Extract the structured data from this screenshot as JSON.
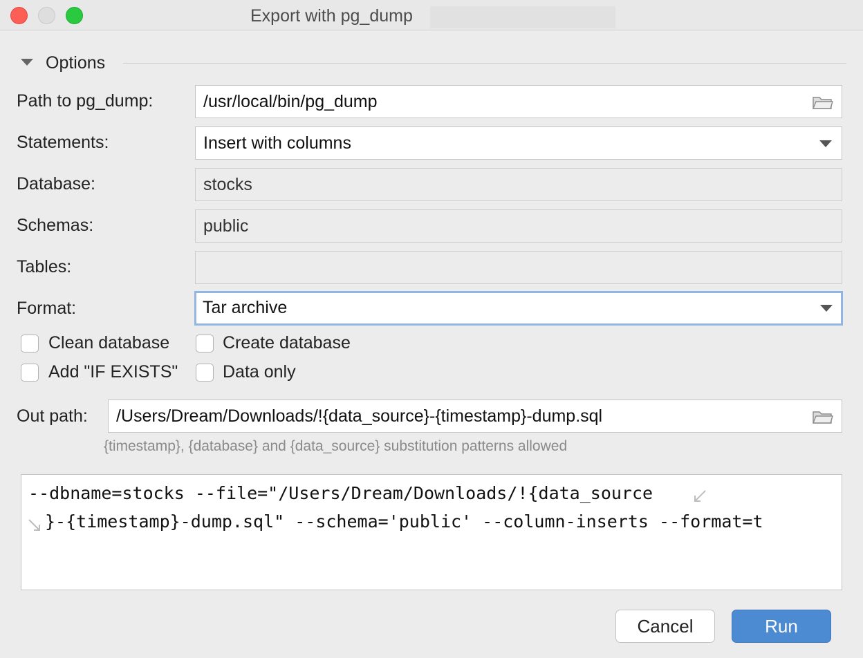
{
  "window": {
    "title": "Export with pg_dump"
  },
  "options": {
    "section_label": "Options",
    "path_label": "Path to pg_dump:",
    "path_value": "/usr/local/bin/pg_dump",
    "statements_label": "Statements:",
    "statements_value": "Insert with columns",
    "database_label": "Database:",
    "database_value": "stocks",
    "schemas_label": "Schemas:",
    "schemas_value": "public",
    "tables_label": "Tables:",
    "tables_value": "",
    "format_label": "Format:",
    "format_value": "Tar archive"
  },
  "checkboxes": {
    "clean_database": {
      "label": "Clean database",
      "checked": false
    },
    "create_database": {
      "label": "Create database",
      "checked": false
    },
    "add_if_exists": {
      "label": "Add \"IF EXISTS\"",
      "checked": false
    },
    "data_only": {
      "label": "Data only",
      "checked": false
    }
  },
  "out_path": {
    "label": "Out path:",
    "value": "/Users/Dream/Downloads/!{data_source}-{timestamp}-dump.sql",
    "hint": "{timestamp}, {database} and {data_source} substitution patterns allowed"
  },
  "command": {
    "line1": "--dbname=stocks --file=\"/Users/Dream/Downloads/!{data_source",
    "line2": "}-{timestamp}-dump.sql\" --schema='public' --column-inserts --format=t"
  },
  "buttons": {
    "cancel": "Cancel",
    "run": "Run"
  },
  "colors": {
    "accent": "#4c8ad2",
    "focus_ring": "#92b6e4",
    "window_bg": "#ececec"
  },
  "icons": [
    "folder-icon",
    "dropdown-arrow-icon",
    "collapse-triangle-icon",
    "soft-wrap-icon"
  ]
}
